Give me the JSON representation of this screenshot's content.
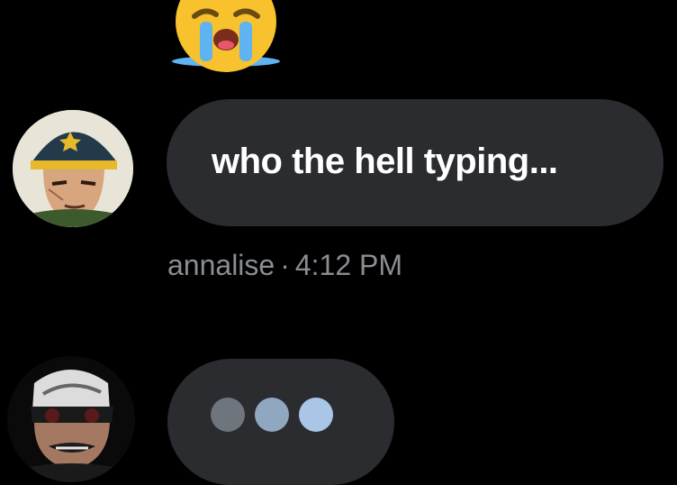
{
  "reaction": {
    "emoji": "😭",
    "icon": "loudly-crying-face-icon"
  },
  "messages": [
    {
      "sender": "annalise",
      "text": "who the hell typing...",
      "separator": "·",
      "time": "4:12 PM",
      "avatar": "anime-officer-avatar"
    }
  ],
  "typing_indicator": {
    "avatar": "anime-villain-avatar",
    "dot_colors": [
      "#6f757d",
      "#8fa7bf",
      "#a9c6e6"
    ]
  },
  "colors": {
    "background": "#000000",
    "bubble": "#2a2c30",
    "meta_text": "#8a8d92"
  }
}
